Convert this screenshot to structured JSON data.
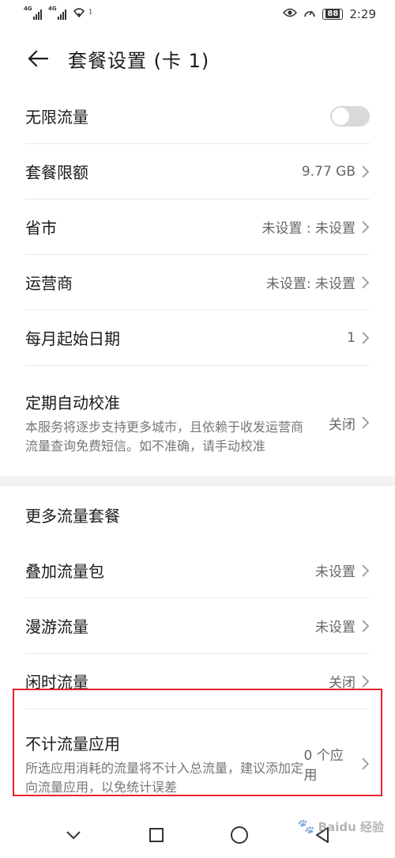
{
  "status_bar": {
    "sim1": "4G",
    "sim2": "4G",
    "wifi_badge": "1",
    "battery": "88",
    "time": "2:29"
  },
  "header": {
    "title": "套餐设置 (卡 1)"
  },
  "rows": [
    {
      "label": "无限流量",
      "toggle_on": false
    },
    {
      "label": "套餐限额",
      "value": "9.77 GB"
    },
    {
      "label": "省市",
      "value": "未设置 : 未设置"
    },
    {
      "label": "运营商",
      "value": "未设置: 未设置"
    },
    {
      "label": "每月起始日期",
      "value": "1"
    },
    {
      "label": "定期自动校准",
      "description": "本服务将逐步支持更多城市，且依赖于收发运营商流量查询免费短信。如不准确，请手动校准",
      "value": "关闭"
    }
  ],
  "section2": {
    "title": "更多流量套餐",
    "rows": [
      {
        "label": "叠加流量包",
        "value": "未设置"
      },
      {
        "label": "漫游流量",
        "value": "未设置"
      },
      {
        "label": "闲时流量",
        "value": "关闭"
      },
      {
        "label": "不计流量应用",
        "description": "所选应用消耗的流量将不计入总流量，建议添加定向流量应用，以免统计误差",
        "value": "0 个应用"
      }
    ]
  },
  "watermark": "Baidu 经验",
  "colors": {
    "highlight": "#e5232c",
    "toggle_off": "#d9d9d9",
    "divider": "#e8e8e8",
    "secondary_text": "#666666"
  },
  "icons": {
    "back": "arrow-left-icon",
    "chevron": "chevron-right-icon",
    "nav_back": "triangle-back-icon",
    "nav_home": "circle-home-icon",
    "nav_recent": "square-recent-icon",
    "nav_down": "chevron-down-icon"
  }
}
